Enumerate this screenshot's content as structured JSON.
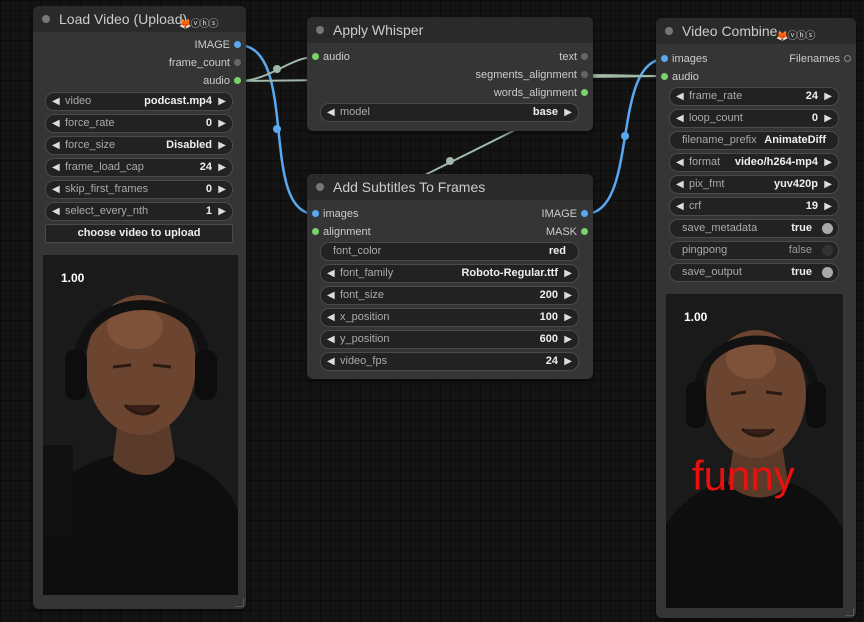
{
  "canvas": {
    "link_colors": {
      "image": "#5aa9f0",
      "audio": "#a0b8a8"
    }
  },
  "load_video": {
    "title": "Load Video (Upload)",
    "badge": "🦊ⓥⓗⓢ",
    "outputs": [
      "IMAGE",
      "frame_count",
      "audio"
    ],
    "widgets": [
      {
        "label": "video",
        "value": "podcast.mp4"
      },
      {
        "label": "force_rate",
        "value": "0"
      },
      {
        "label": "force_size",
        "value": "Disabled"
      },
      {
        "label": "frame_load_cap",
        "value": "24"
      },
      {
        "label": "skip_first_frames",
        "value": "0"
      },
      {
        "label": "select_every_nth",
        "value": "1"
      }
    ],
    "upload_button": "choose video to upload",
    "preview_scale": "1.00"
  },
  "apply_whisper": {
    "title": "Apply Whisper",
    "input": "audio",
    "outputs": [
      "text",
      "segments_alignment",
      "words_alignment"
    ],
    "widgets": [
      {
        "label": "model",
        "value": "base"
      }
    ]
  },
  "add_subtitles": {
    "title": "Add Subtitles To Frames",
    "inputs": [
      "images",
      "alignment"
    ],
    "outputs": [
      "IMAGE",
      "MASK"
    ],
    "widgets": [
      {
        "label": "font_color",
        "value": "red"
      },
      {
        "label": "font_family",
        "value": "Roboto-Regular.ttf"
      },
      {
        "label": "font_size",
        "value": "200"
      },
      {
        "label": "x_position",
        "value": "100"
      },
      {
        "label": "y_position",
        "value": "600"
      },
      {
        "label": "video_fps",
        "value": "24"
      }
    ]
  },
  "video_combine": {
    "title": "Video Combine",
    "badge": "🦊ⓥⓗⓢ",
    "inputs": [
      "images",
      "audio"
    ],
    "output": "Filenames",
    "widgets": [
      {
        "label": "frame_rate",
        "value": "24"
      },
      {
        "label": "loop_count",
        "value": "0"
      },
      {
        "label": "filename_prefix",
        "value": "AnimateDiff"
      },
      {
        "label": "format",
        "value": "video/h264-mp4"
      },
      {
        "label": "pix_fmt",
        "value": "yuv420p"
      },
      {
        "label": "crf",
        "value": "19"
      },
      {
        "label": "save_metadata",
        "value": "true"
      },
      {
        "label": "pingpong",
        "value": "false"
      },
      {
        "label": "save_output",
        "value": "true"
      }
    ],
    "preview_scale": "1.00",
    "subtitle_word": "funny"
  }
}
